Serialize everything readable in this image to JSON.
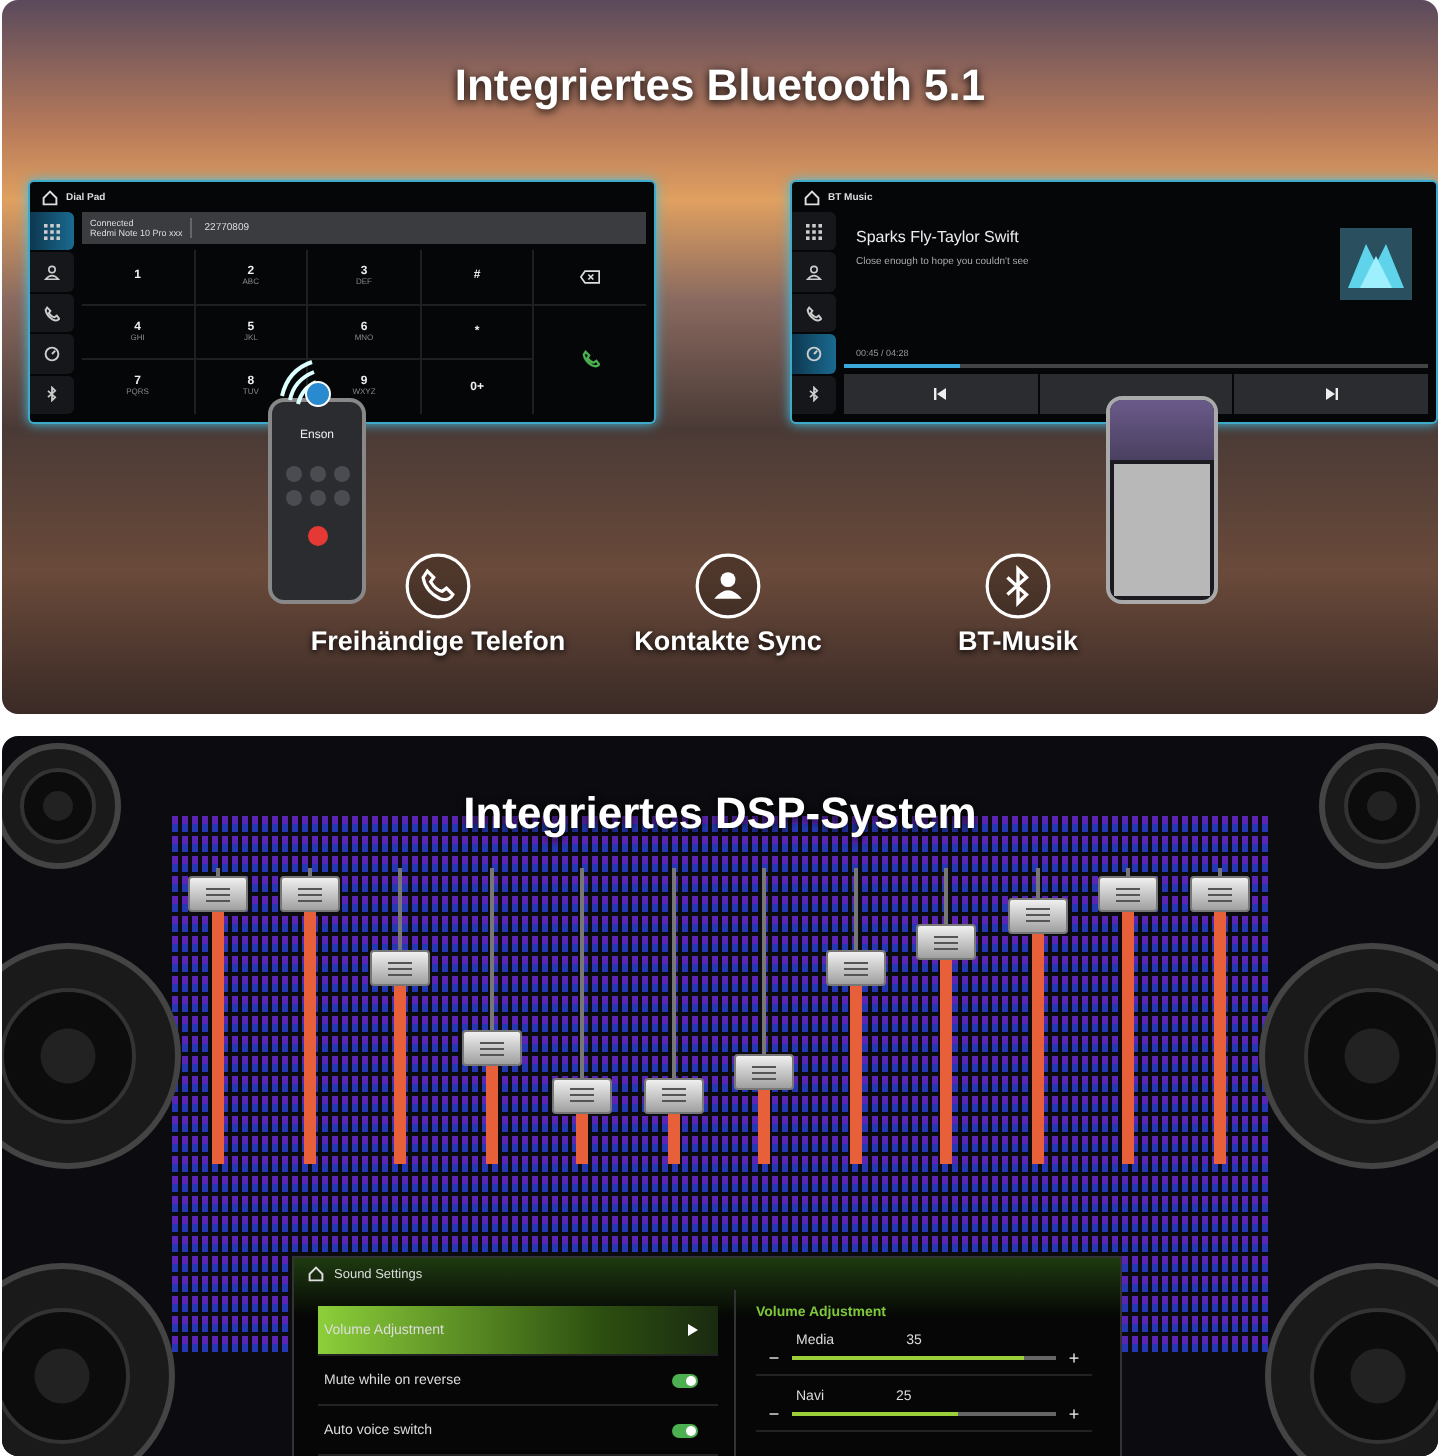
{
  "bluetooth_banner": {
    "title": "Integriertes Bluetooth 5.1",
    "dial_pad": {
      "title": "Dial Pad",
      "status": "Connected",
      "device": "Redmi Note 10 Pro xxx",
      "number": "22770809",
      "sidebar": [
        {
          "kind": "grid",
          "selected": true
        },
        {
          "kind": "person",
          "selected": false
        },
        {
          "kind": "calls",
          "selected": false
        },
        {
          "kind": "gauge",
          "selected": false
        },
        {
          "kind": "bluetooth",
          "selected": false
        }
      ],
      "keys": [
        {
          "digit": "1"
        },
        {
          "digit": "2",
          "letters": "ABC"
        },
        {
          "digit": "3",
          "letters": "DEF"
        },
        {
          "digit": "#"
        },
        {
          "digit": "4",
          "letters": "GHI"
        },
        {
          "digit": "5",
          "letters": "JKL"
        },
        {
          "digit": "6",
          "letters": "MNO"
        },
        {
          "digit": "*"
        },
        {
          "digit": "7",
          "letters": "PQRS"
        },
        {
          "digit": "8",
          "letters": "TUV"
        },
        {
          "digit": "9",
          "letters": "WXYZ"
        },
        {
          "digit": "0+"
        }
      ]
    },
    "phone_call": {
      "caller": "Enson"
    },
    "bt_music": {
      "title": "BT Music",
      "song": "Sparks Fly-Taylor Swift",
      "lyric": "Close enough to hope you couldn't see",
      "time": "00:45 / 04:28",
      "level": 0.2,
      "sidebar": [
        {
          "kind": "grid",
          "selected": false
        },
        {
          "kind": "person",
          "selected": false
        },
        {
          "kind": "calls",
          "selected": false
        },
        {
          "kind": "gauge",
          "selected": true
        },
        {
          "kind": "bluetooth",
          "selected": false
        }
      ]
    },
    "features": [
      {
        "kind": "phone",
        "label": "Freihändige Telefon"
      },
      {
        "kind": "contacts",
        "label": "Kontakte Sync"
      },
      {
        "kind": "bluetooth",
        "label": "BT-Musik"
      }
    ]
  },
  "dsp_banner": {
    "title": "Integriertes DSP-System",
    "faders": [
      {
        "level": 0.91
      },
      {
        "level": 0.91
      },
      {
        "level": 0.66
      },
      {
        "level": 0.39
      },
      {
        "level": 0.23
      },
      {
        "level": 0.23
      },
      {
        "level": 0.31
      },
      {
        "level": 0.66
      },
      {
        "level": 0.75
      },
      {
        "level": 0.84
      },
      {
        "level": 0.91
      },
      {
        "level": 0.91
      }
    ],
    "sound_settings": {
      "title": "Sound Settings",
      "menu": [
        {
          "kind": "link",
          "label": "Volume Adjustment",
          "selected": true
        },
        {
          "kind": "toggle",
          "label": "Mute while on reverse",
          "on": true
        },
        {
          "kind": "toggle",
          "label": "Auto voice switch",
          "on": true
        }
      ],
      "volume": {
        "title": "Volume Adjustment",
        "channels": [
          {
            "name": "Media",
            "value": "35",
            "level": 0.88,
            "minus": "−",
            "plus": "+"
          },
          {
            "name": "Navi",
            "value": "25",
            "level": 0.63,
            "minus": "−",
            "plus": "+"
          }
        ]
      }
    }
  }
}
